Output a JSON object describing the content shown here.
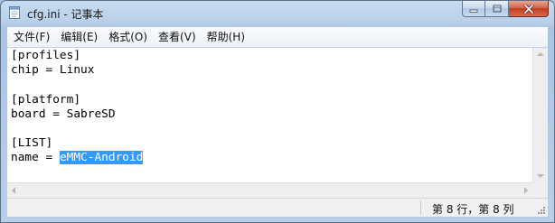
{
  "window": {
    "title": "cfg.ini - 记事本"
  },
  "colors": {
    "selection": "#3399ff",
    "close_button": "#c7452a",
    "frame": "#b9d0ea"
  },
  "menu": {
    "items": [
      "文件(F)",
      "编辑(E)",
      "格式(O)",
      "查看(V)",
      "帮助(H)"
    ]
  },
  "editor": {
    "lines": [
      "[profiles]",
      "chip = Linux",
      "",
      "[platform]",
      "board = SabreSD",
      "",
      "[LIST]"
    ],
    "last_line_prefix": "name = ",
    "selected_text": "eMMC-Android"
  },
  "statusbar": {
    "position": "第 8 行，第 8 列"
  }
}
